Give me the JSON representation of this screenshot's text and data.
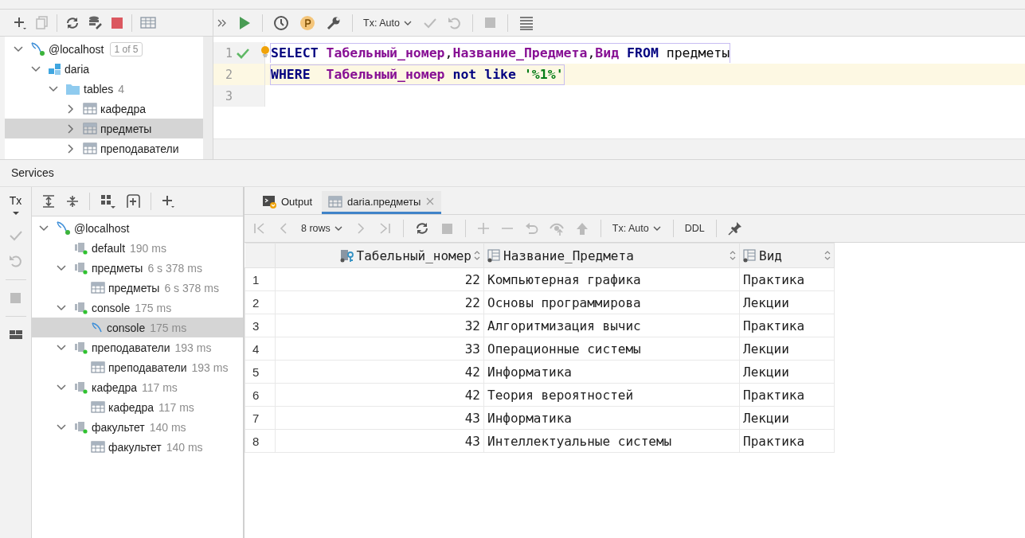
{
  "explorer": {
    "tree": [
      {
        "label": "@localhost",
        "kind": "host",
        "badge": "1 of 5",
        "expanded": true,
        "selected": false,
        "children": [
          {
            "label": "daria",
            "kind": "schema",
            "expanded": true,
            "selected": false,
            "children": [
              {
                "label": "tables",
                "kind": "folder",
                "count": "4",
                "expanded": true,
                "selected": false,
                "children": [
                  {
                    "label": "кафедра",
                    "kind": "table",
                    "expanded": false,
                    "selected": false
                  },
                  {
                    "label": "предметы",
                    "kind": "table",
                    "expanded": false,
                    "selected": true
                  },
                  {
                    "label": "преподаватели",
                    "kind": "table",
                    "expanded": false,
                    "selected": false
                  }
                ]
              }
            ]
          }
        ]
      }
    ]
  },
  "editor": {
    "tx_mode": "Tx: Auto",
    "lines": [
      {
        "number": "1",
        "passed": true,
        "current": false,
        "tokens": [
          {
            "kind": "keyword",
            "text": "SELECT "
          },
          {
            "kind": "column",
            "text": "Табельный_номер"
          },
          {
            "kind": "plain",
            "text": ","
          },
          {
            "kind": "column",
            "text": "Название_Предмета"
          },
          {
            "kind": "plain",
            "text": ","
          },
          {
            "kind": "column",
            "text": "Вид "
          },
          {
            "kind": "keyword",
            "text": "FROM "
          },
          {
            "kind": "plain",
            "text": "предметы"
          }
        ]
      },
      {
        "number": "2",
        "passed": false,
        "current": true,
        "tokens": [
          {
            "kind": "keyword",
            "text": "WHERE  "
          },
          {
            "kind": "column",
            "text": "Табельный_номер "
          },
          {
            "kind": "keyword",
            "text": "not like "
          },
          {
            "kind": "string",
            "text": "'%1%'"
          }
        ]
      },
      {
        "number": "3",
        "passed": false,
        "current": false
      }
    ]
  },
  "services": {
    "title": "Services",
    "tx_label": "Tx",
    "tree": [
      {
        "label": "@localhost",
        "kind": "host",
        "expanded": true,
        "selected": false,
        "children": [
          {
            "label": "default",
            "kind": "session",
            "time": "190 ms",
            "selected": false
          },
          {
            "label": "предметы",
            "kind": "session",
            "time": "6 s 378 ms",
            "expanded": true,
            "selected": false,
            "children": [
              {
                "label": "предметы",
                "kind": "table",
                "time": "6 s 378 ms",
                "selected": false
              }
            ]
          },
          {
            "label": "console",
            "kind": "session",
            "time": "175 ms",
            "expanded": true,
            "selected": false,
            "children": [
              {
                "label": "console",
                "kind": "console",
                "time": "175 ms",
                "selected": true
              }
            ]
          },
          {
            "label": "преподаватели",
            "kind": "session",
            "time": "193 ms",
            "expanded": true,
            "selected": false,
            "children": [
              {
                "label": "преподаватели",
                "kind": "table",
                "time": "193 ms",
                "selected": false
              }
            ]
          },
          {
            "label": "кафедра",
            "kind": "session",
            "time": "117 ms",
            "expanded": true,
            "selected": false,
            "children": [
              {
                "label": "кафедра",
                "kind": "table",
                "time": "117 ms",
                "selected": false
              }
            ]
          },
          {
            "label": "факультет",
            "kind": "session",
            "time": "140 ms",
            "expanded": true,
            "selected": false,
            "children": [
              {
                "label": "факультет",
                "kind": "table",
                "time": "140 ms",
                "selected": false
              }
            ]
          }
        ]
      }
    ]
  },
  "results": {
    "tabs": [
      {
        "label": "Output",
        "kind": "output",
        "selected": false,
        "closable": false
      },
      {
        "label": "daria.предметы",
        "kind": "table",
        "selected": true,
        "closable": true
      }
    ],
    "rows_label": "8 rows",
    "tx_mode": "Tx: Auto",
    "ddl_label": "DDL",
    "table": {
      "columns": [
        {
          "label": "Табельный_номер",
          "kind": "key"
        },
        {
          "label": "Название_Предмета",
          "kind": "column"
        },
        {
          "label": "Вид",
          "kind": "column"
        }
      ],
      "rows": [
        {
          "number": "1",
          "cells": [
            "22",
            "Компьютерная графика",
            "Практика"
          ]
        },
        {
          "number": "2",
          "cells": [
            "22",
            "Основы программирова",
            "Лекции"
          ]
        },
        {
          "number": "3",
          "cells": [
            "32",
            "Алгоритмизация вычис",
            "Практика"
          ]
        },
        {
          "number": "4",
          "cells": [
            "33",
            "Операционные системы",
            "Лекции"
          ]
        },
        {
          "number": "5",
          "cells": [
            "42",
            "Информатика",
            "Лекции"
          ]
        },
        {
          "number": "6",
          "cells": [
            "42",
            "Теория вероятностей",
            "Практика"
          ]
        },
        {
          "number": "7",
          "cells": [
            "43",
            "Информатика",
            "Лекции"
          ]
        },
        {
          "number": "8",
          "cells": [
            "43",
            "Интеллектуальные системы",
            "Практика"
          ]
        }
      ]
    }
  }
}
